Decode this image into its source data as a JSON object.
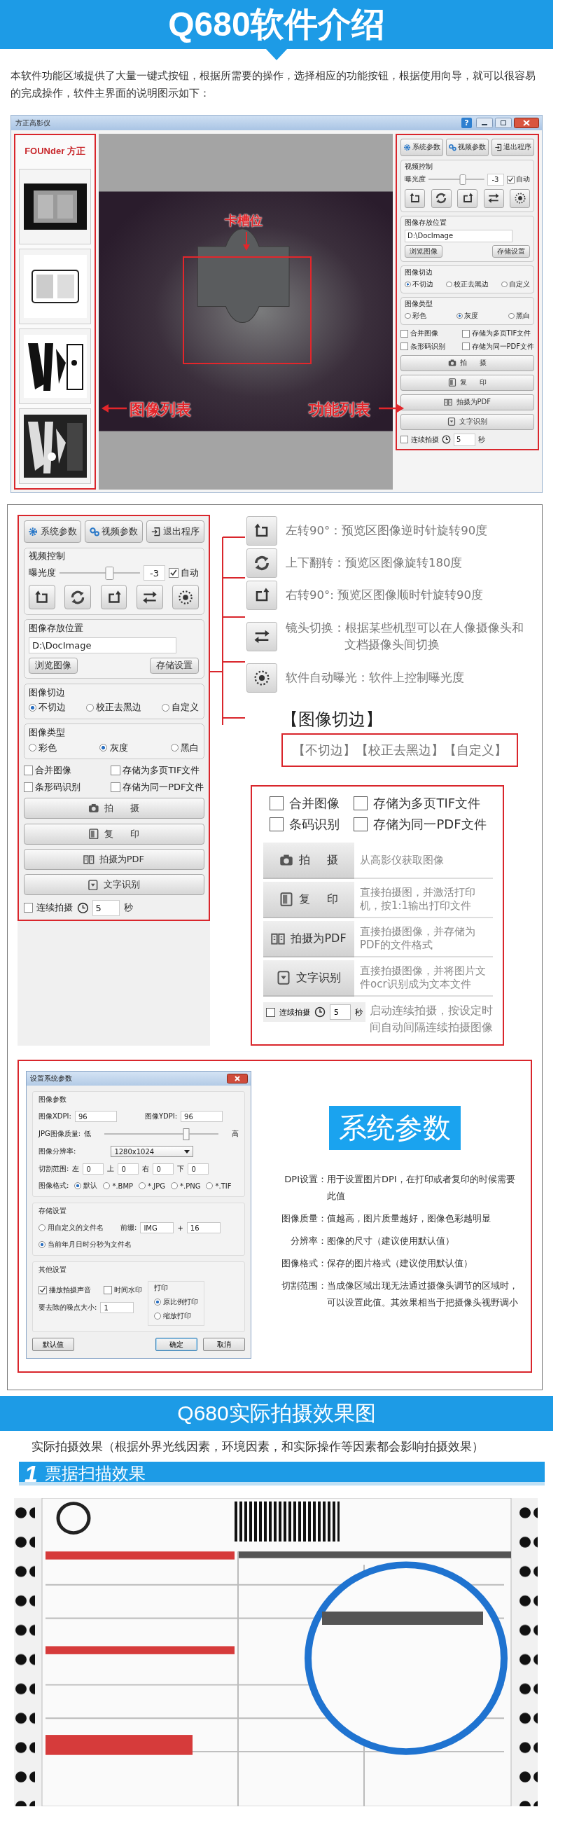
{
  "header": {
    "title": "Q680软件介绍"
  },
  "intro": "本软件功能区域提供了大量一键式按钮，根据所需要的操作，选择相应的功能按钮，根据使用向导，就可以很容易的完成操作，软件主界面的说明图示如下：",
  "app_window": {
    "title": "方正高影仪",
    "help": "?",
    "logo": "FOUNder 方正",
    "slot_label": "卡槽位",
    "list_label": "图像列表",
    "function_label": "功能列表",
    "panel": {
      "top_buttons": [
        "系统参数",
        "视频参数",
        "退出程序"
      ],
      "video": {
        "legend": "视频控制",
        "exposure_label": "曝光度",
        "level": 0.62,
        "value": "-3",
        "auto_label": "自动",
        "auto_checked": true
      },
      "storage": {
        "legend": "图像存放位置",
        "path": "D:\\DocImage",
        "buttons": [
          "浏览图像",
          "存储设置"
        ]
      },
      "crop": {
        "legend": "图像切边",
        "options": [
          {
            "label": "不切边",
            "selected": true
          },
          {
            "label": "校正去黑边",
            "selected": false
          },
          {
            "label": "自定义",
            "selected": false
          }
        ]
      },
      "type": {
        "legend": "图像类型",
        "options": [
          {
            "label": "彩色",
            "selected": false
          },
          {
            "label": "灰度",
            "selected": true
          },
          {
            "label": "黑白",
            "selected": false
          }
        ]
      },
      "checks": [
        {
          "label": "合并图像",
          "checked": false
        },
        {
          "label": "存储为多页TIF文件",
          "checked": false
        },
        {
          "label": "条形码识别",
          "checked": false
        },
        {
          "label": "存储为同一PDF文件",
          "checked": false
        }
      ],
      "actions": [
        "拍 摄",
        "复 印",
        "拍摄为PDF",
        "文字识别"
      ],
      "continuous": {
        "label": "连续拍摄",
        "checked": false,
        "seconds": "5",
        "unit": "秒"
      }
    }
  },
  "detail": {
    "panel": {
      "top_buttons": [
        "系统参数",
        "视频参数",
        "退出程序"
      ],
      "video": {
        "legend": "视频控制",
        "exposure_label": "曝光度",
        "level": 0.62,
        "value": "-3",
        "auto_label": "自动",
        "auto_checked": true
      },
      "storage": {
        "legend": "图像存放位置",
        "path": "D:\\DocImage",
        "buttons": [
          "浏览图像",
          "存储设置"
        ]
      },
      "crop": {
        "legend": "图像切边",
        "options": [
          {
            "label": "不切边",
            "selected": true
          },
          {
            "label": "校正去黑边",
            "selected": false
          },
          {
            "label": "自定义",
            "selected": false
          }
        ]
      },
      "type": {
        "legend": "图像类型",
        "options": [
          {
            "label": "彩色",
            "selected": false
          },
          {
            "label": "灰度",
            "selected": true
          },
          {
            "label": "黑白",
            "selected": false
          }
        ]
      },
      "checks": [
        {
          "label": "合并图像",
          "checked": false
        },
        {
          "label": "存储为多页TIF文件",
          "checked": false
        },
        {
          "label": "条形码识别",
          "checked": false
        },
        {
          "label": "存储为同一PDF文件",
          "checked": false
        }
      ],
      "actions": [
        "拍 摄",
        "复 印",
        "拍摄为PDF",
        "文字识别"
      ],
      "continuous": {
        "label": "连续拍摄",
        "checked": false,
        "seconds": "5",
        "unit": "秒"
      }
    },
    "tools": [
      "左转90°：预览区图像逆时针旋转90度",
      "上下翻转：预览区图像旋转180度",
      "右转90°: 预览区图像顺时针旋转90度",
      "镜头切换：根据某些机型可以在人像摄像头和文档摄像头间切换",
      "软件自动曝光：软件上控制曝光度"
    ],
    "crop_heading": "【图像切边】",
    "crop_options": "【不切边】【校正去黑边】【自定义】",
    "options": [
      {
        "label": "合并图像",
        "checked": false
      },
      {
        "label": "存储为多页TIF文件",
        "checked": false
      },
      {
        "label": "条码识别",
        "checked": false
      },
      {
        "label": "存储为同一PDF文件",
        "checked": false
      }
    ],
    "actions": [
      {
        "label": "拍 摄",
        "desc": "从高影仪获取图像"
      },
      {
        "label": "复 印",
        "desc": "直接拍摄图，并激活打印机，按1:1输出打印文件"
      },
      {
        "label": "拍摄为PDF",
        "desc": "直接拍摄图像，并存储为PDF的文件格式"
      },
      {
        "label": "文字识别",
        "desc": "直接拍摄图像，并将图片文件ocr识别成为文本文件"
      }
    ],
    "continuous": {
      "label": "连续拍摄",
      "checked": false,
      "seconds": "5",
      "unit": "秒",
      "desc": "启动连续拍摄，按设定时间自动间隔连续拍摄图像"
    }
  },
  "dialog": {
    "title": "设置系统参数",
    "image_group": {
      "legend": "图像参数",
      "xdpi_label": "图像XDPI:",
      "xdpi": "96",
      "ydpi_label": "图像YDPI:",
      "ydpi": "96",
      "quality_label": "JPG图像质量:",
      "quality_low": "低",
      "quality_high": "高",
      "level": 0.72,
      "resolution_label": "图像分辨率:",
      "resolution": "1280x1024",
      "crop_label": "切割范围:",
      "crop": [
        {
          "label": "左",
          "value": "0"
        },
        {
          "label": "上",
          "value": "0"
        },
        {
          "label": "右",
          "value": "0"
        },
        {
          "label": "下",
          "value": "0"
        }
      ],
      "format_label": "图像格式:",
      "formats": [
        {
          "label": "默认",
          "selected": true
        },
        {
          "label": "*.BMP",
          "selected": false
        },
        {
          "label": "*.JPG",
          "selected": false
        },
        {
          "label": "*.PNG",
          "selected": false
        },
        {
          "label": "*.TIF",
          "selected": false
        }
      ]
    },
    "storage_group": {
      "legend": "存储设置",
      "naming": [
        {
          "label": "用自定义的文件名",
          "selected": false
        },
        {
          "label": "当前年月日时分秒为文件名",
          "selected": true
        }
      ],
      "prefix_label": "前缀:",
      "prefix": "IMG",
      "plus": "+",
      "number": "16"
    },
    "other_group": {
      "legend": "其他设置",
      "checks": [
        {
          "label": "播放拍摄声音",
          "checked": true
        },
        {
          "label": "时间水印",
          "checked": false
        }
      ],
      "noise_label": "要去除的噪点大小:",
      "noise": "1",
      "print_legend": "打印",
      "print": [
        {
          "label": "原比例打印",
          "selected": true
        },
        {
          "label": "缩放打印",
          "selected": false
        }
      ]
    },
    "buttons": [
      {
        "label": "默认值",
        "default": false
      },
      {
        "label": "确定",
        "default": true
      },
      {
        "label": "取消",
        "default": false
      }
    ]
  },
  "system_params": {
    "badge": "系统参数",
    "notes": [
      {
        "term": "DPI设置：",
        "text": "用于设置图片DPI，在打印或者复印的时候需要此值"
      },
      {
        "term": "图像质量：",
        "text": "值越高，图片质量越好，图像色彩越明显"
      },
      {
        "term": "分辨率：",
        "text": "图像的尺寸（建议使用默认值）"
      },
      {
        "term": "图像格式：",
        "text": "保存的图片格式（建议使用默认值）"
      },
      {
        "term": "切割范围：",
        "text": "当成像区域出现无法通过摄像头调节的区域时，可以设置此值。其效果相当于把摄像头视野调小"
      }
    ]
  },
  "results": {
    "banner": "Q680实际拍摄效果图",
    "note": "实际拍摄效果（根据外界光线因素，环境因素，和实际操作等因素都会影响拍摄效果）",
    "step": {
      "number": "1",
      "title": "票据扫描效果"
    }
  }
}
